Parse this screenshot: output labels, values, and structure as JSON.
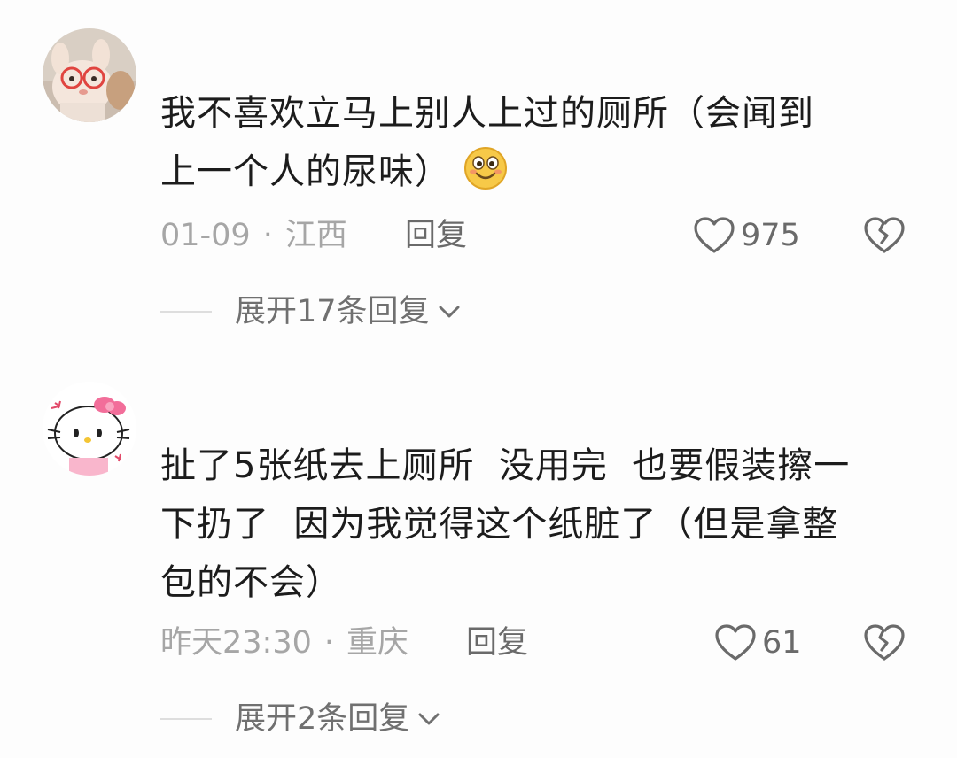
{
  "comments": [
    {
      "avatar": "plush-bunny-with-glasses-avatar",
      "text_lines": [
        "我不喜欢立马上别人上过的厕所（会闻到",
        "上一个人的尿味）"
      ],
      "emoji": "smiling-face-emoji",
      "date": "01-09",
      "separator": "·",
      "location": "江西",
      "reply_label": "回复",
      "like_count": "975",
      "like_icon": "heart-outline-icon",
      "dislike_icon": "broken-heart-icon",
      "expand_label": "展开17条回复",
      "expand_icon": "chevron-down-icon"
    },
    {
      "avatar": "hello-kitty-angry-avatar",
      "text_lines": [
        "扯了5张纸去上厕所  没用完  也要假装擦一",
        "下扔了  因为我觉得这个纸脏了（但是拿整",
        "包的不会）"
      ],
      "date": "昨天23:30",
      "separator": "·",
      "location": "重庆",
      "reply_label": "回复",
      "like_count": "61",
      "like_icon": "heart-outline-icon",
      "dislike_icon": "broken-heart-icon",
      "expand_label": "展开2条回复",
      "expand_icon": "chevron-down-icon"
    }
  ],
  "colors": {
    "background": "#fdfdfd",
    "text": "#1c1c1c",
    "meta": "#a6a6a6",
    "action": "#6a6a6a"
  }
}
